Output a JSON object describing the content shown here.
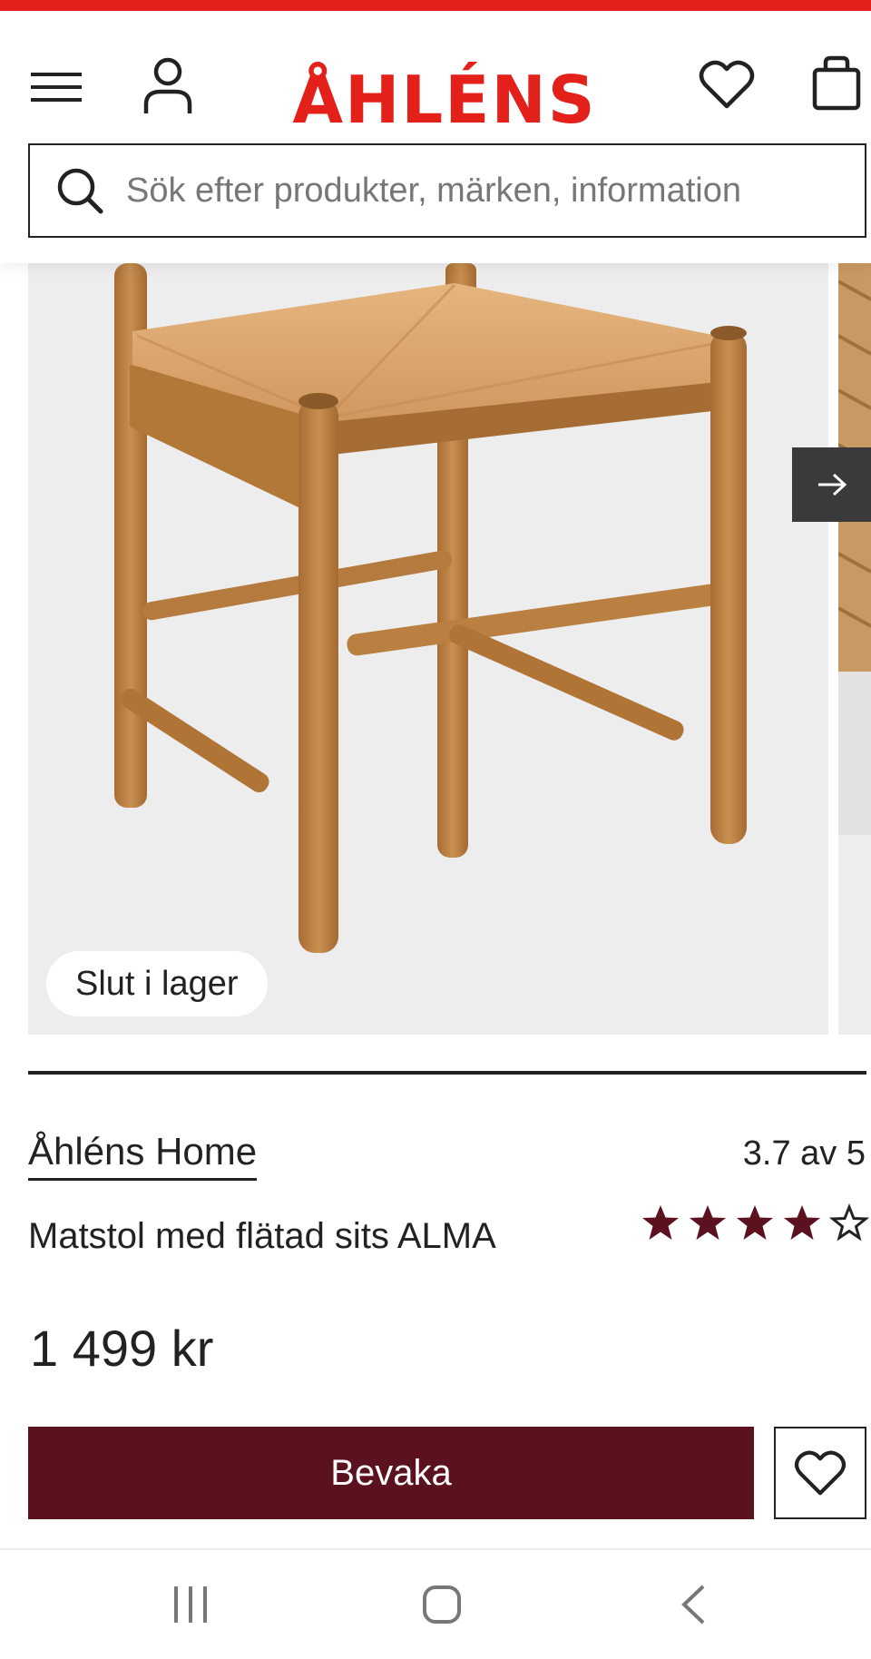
{
  "brand_color": "#e3211a",
  "accent_color": "#5c111f",
  "header": {
    "logo_text": "ÅHLÉNS",
    "icons": [
      "menu-icon",
      "account-icon",
      "heart-icon",
      "shopping-bag-icon"
    ]
  },
  "search": {
    "placeholder": "Sök efter produkter, märken, information"
  },
  "gallery": {
    "stock_badge": "Slut i lager",
    "icons": [
      "arrow-right-icon"
    ]
  },
  "product": {
    "brand": "Åhléns Home",
    "title": "Matstol med flätad sits ALMA",
    "rating_text": "3.7 av 5",
    "rating": 3.7,
    "rating_max": 5,
    "price": "1 499 kr"
  },
  "actions": {
    "watch_label": "Bevaka",
    "wishlist_icon": "heart-icon"
  },
  "system_nav": {
    "icons": [
      "recent-apps-icon",
      "home-icon",
      "back-icon"
    ]
  }
}
